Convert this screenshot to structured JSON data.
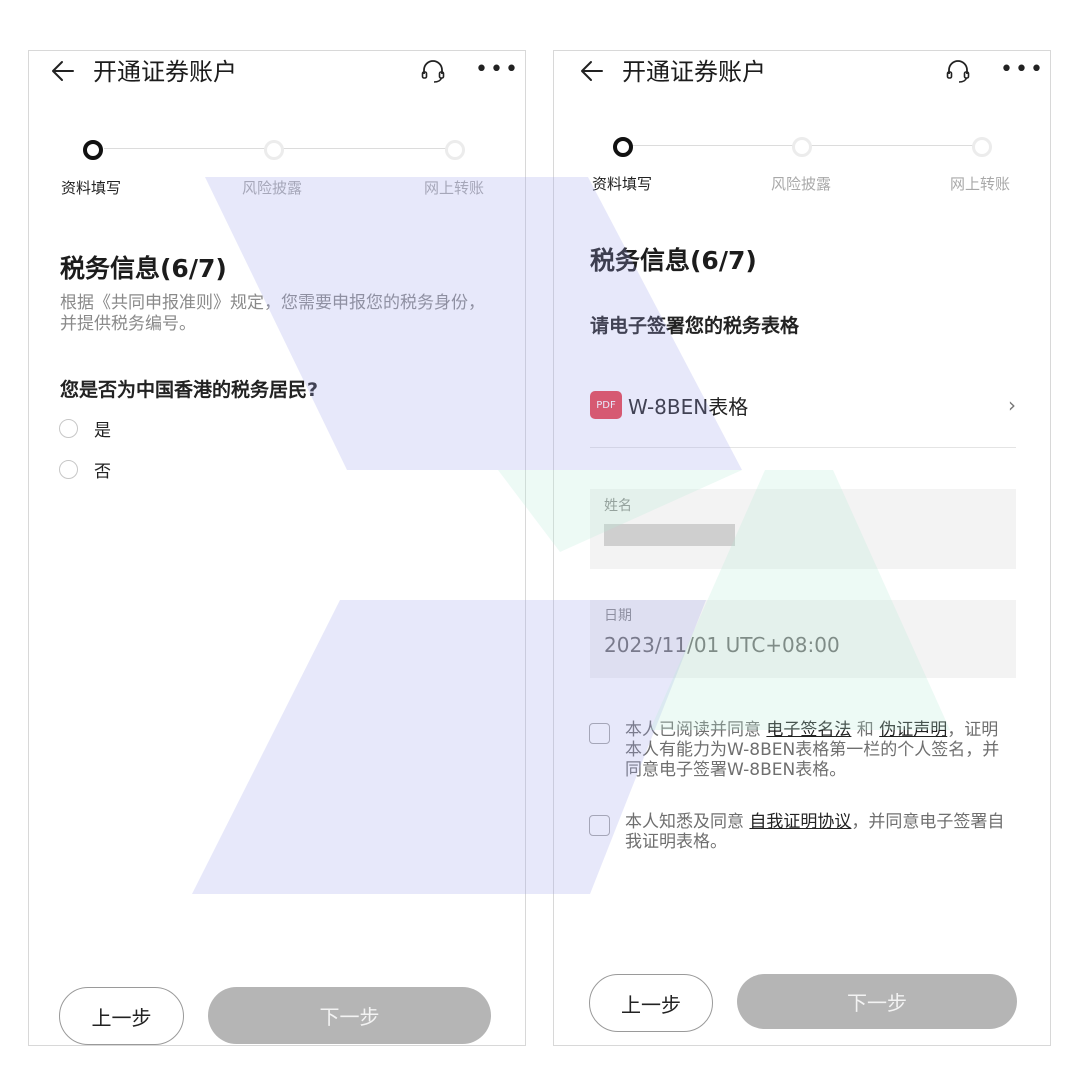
{
  "left": {
    "title": "开通证券账户",
    "steps": [
      "资料填写",
      "风险披露",
      "网上转账"
    ],
    "section_title": "税务信息(6/7)",
    "description": "根据《共同申报准则》规定，您需要申报您的税务身份，并提供税务编号。",
    "question": "您是否为中国香港的税务居民?",
    "options": [
      "是",
      "否"
    ],
    "prev_label": "上一步",
    "next_label": "下一步"
  },
  "right": {
    "title": "开通证券账户",
    "steps": [
      "资料填写",
      "风险披露",
      "网上转账"
    ],
    "section_title": "税务信息(6/7)",
    "sub_title": "请电子签署您的税务表格",
    "pdf_badge": "PDF",
    "pdf_name": "W-8BEN表格",
    "chevron": "›",
    "name_label": "姓名",
    "date_label": "日期",
    "date_value": "2023/11/01 UTC+08:00",
    "agree1": {
      "pre": "本人已阅读并同意 ",
      "link1": "电子签名法",
      "mid": " 和 ",
      "link2": "伪证声明",
      "post": "，证明本人有能力为W-8BEN表格第一栏的个人签名，并同意电子签署W-8BEN表格。"
    },
    "agree2": {
      "pre": "本人知悉及同意 ",
      "link": "自我证明协议",
      "post": "，并同意电子签署自我证明表格。"
    },
    "prev_label": "上一步",
    "next_label": "下一步"
  },
  "icons": {
    "back": "arrow-left",
    "service": "headset",
    "more": "ellipsis",
    "more_glyph": "•••"
  },
  "colors": {
    "pdf_badge": "#e8404a",
    "next_button": "#b5b5b5",
    "active_step": "#111111",
    "field_bg": "#f3f3f3"
  }
}
